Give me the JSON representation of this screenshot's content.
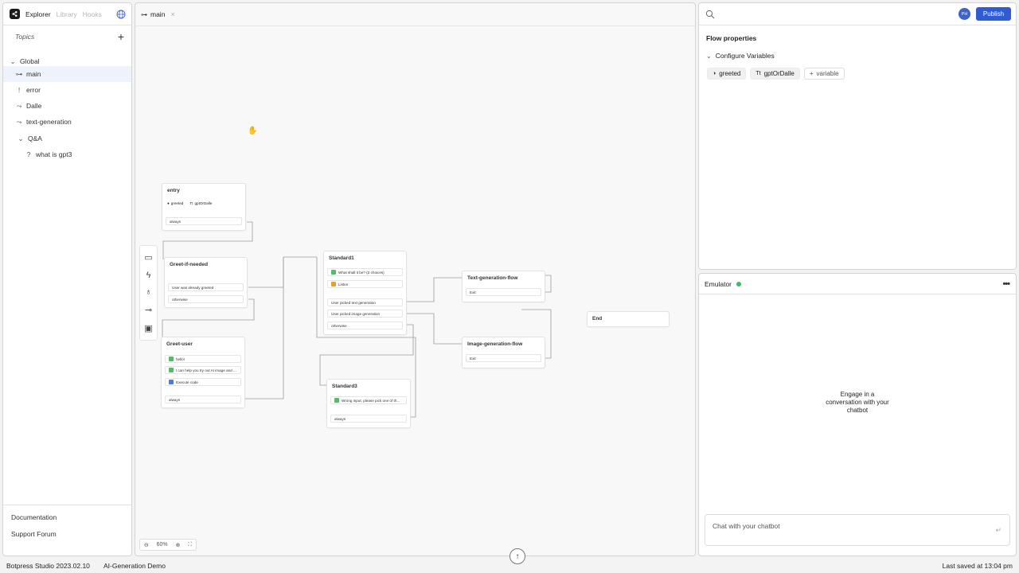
{
  "sidebar": {
    "tabs": [
      "Explorer",
      "Library",
      "Hooks"
    ],
    "topics_label": "Topics",
    "add_icon": "plus-icon",
    "tree": {
      "global": "Global",
      "main": "main",
      "error": "error",
      "dalle": "Dalle",
      "text_generation": "text-generation",
      "qa": "Q&A",
      "what_is_gpt3": "what is gpt3"
    },
    "bottom": {
      "documentation": "Documentation",
      "support": "Support Forum"
    }
  },
  "canvas": {
    "tab_label": "main",
    "zoom": "60%",
    "nodes": {
      "entry": {
        "title": "entry",
        "var1": "greeted",
        "var2": "gptOrDalle",
        "always": "always"
      },
      "greet_if_needed": {
        "title": "Greet-if-needed",
        "cond1": "User was already greeted",
        "otherwise": "otherwise"
      },
      "greet_user": {
        "title": "Greet-user",
        "r1": "hello!",
        "r2": "I can help you try out AI image and ...",
        "r3": "Execute code",
        "always": "always"
      },
      "standard1": {
        "title": "Standard1",
        "r1": "What shall it be? (2 choices)",
        "r2": "Listen",
        "c1": "User picked text generation",
        "c2": "User picked image generation",
        "otherwise": "otherwise"
      },
      "standard3": {
        "title": "Standard3",
        "r1": "Wrong input, please pick one of th...",
        "always": "always"
      },
      "text_flow": {
        "title": "Text-generation-flow",
        "exit": "Exit"
      },
      "image_flow": {
        "title": "Image-generation-flow",
        "exit": "Exit"
      },
      "end": {
        "title": "End"
      }
    }
  },
  "props": {
    "avatar": "PH",
    "publish": "Publish",
    "title": "Flow properties",
    "configure": "Configure Variables",
    "variables": [
      "greeted",
      "gptOrDalle"
    ],
    "add_variable": "variable"
  },
  "emulator": {
    "title": "Emulator",
    "placeholder_line1": "Engage in a",
    "placeholder_line2": "conversation with your",
    "placeholder_line3": "chatbot",
    "input_placeholder": "Chat with your chatbot"
  },
  "footer": {
    "version": "Botpress Studio 2023.02.10",
    "project": "AI-Generation Demo",
    "saved": "Last saved at 13:04 pm"
  },
  "colors": {
    "accent": "#2f5bd3",
    "status": "#3cba67"
  }
}
